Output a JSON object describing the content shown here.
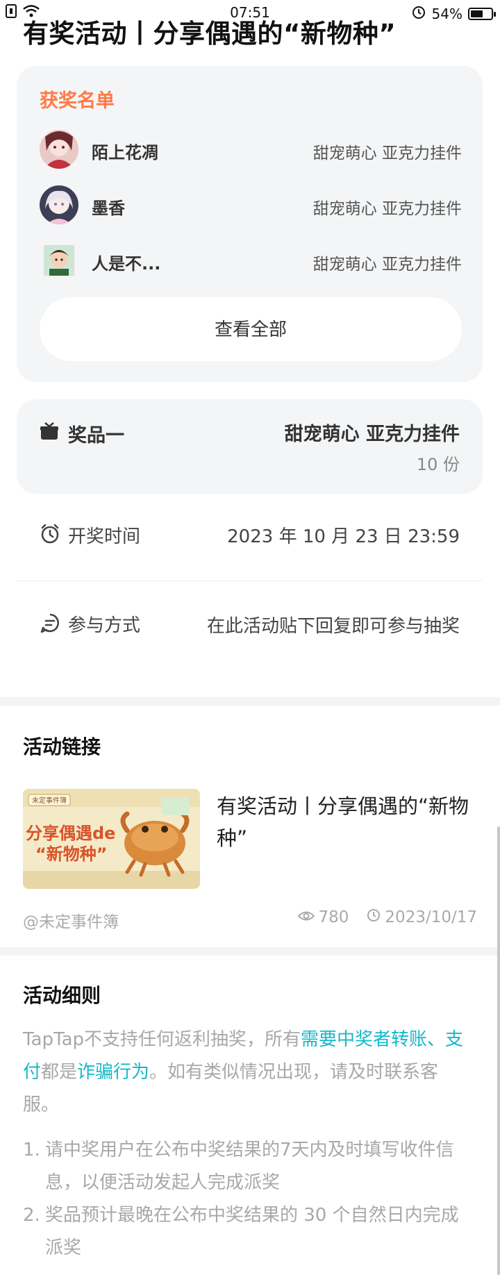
{
  "status_bar": {
    "time": "07:51",
    "battery": "54%",
    "battery_level": 0.54,
    "icons": [
      "sim-icon",
      "wifi-icon",
      "alarm-icon",
      "battery-icon"
    ]
  },
  "page": {
    "title": "有奖活动丨分享偶遇的“新物种”"
  },
  "winners": {
    "heading": "获奖名单",
    "heading_color": "#ff7a45",
    "items": [
      {
        "name": "陌上花凋",
        "prize": "甜宠萌心 亚克力挂件"
      },
      {
        "name": "墨香",
        "prize": "甜宠萌心 亚克力挂件"
      },
      {
        "name": "人是不...",
        "prize": "甜宠萌心 亚克力挂件"
      }
    ],
    "view_all": "查看全部"
  },
  "prize": {
    "label": "奖品一",
    "name": "甜宠萌心 亚克力挂件",
    "quantity": "10 份"
  },
  "draw_time": {
    "label": "开奖时间",
    "value": "2023 年 10 月 23 日 23:59"
  },
  "participation": {
    "label": "参与方式",
    "value": "在此活动贴下回复即可参与抽奖"
  },
  "activity_link": {
    "section_title": "活动链接",
    "title": "有奖活动丨分享偶遇的“新物种”",
    "author": "@未定事件簿",
    "views": "780",
    "date": "2023/10/17"
  },
  "rules": {
    "section_title": "活动细则",
    "intro_parts": [
      {
        "text": "TapTap不支持任何返利抽奖，所有",
        "highlight": false
      },
      {
        "text": "需要中奖者转账、支付",
        "highlight": true
      },
      {
        "text": "都是",
        "highlight": false
      },
      {
        "text": "诈骗行为",
        "highlight": true
      },
      {
        "text": "。如有类似情况出现，请及时联系客服。",
        "highlight": false
      }
    ],
    "highlight_color": "#14b9c8",
    "items": [
      {
        "num": "1.",
        "text": "请中奖用户在公布中奖结果的7天内及时填写收件信息，以便活动发起人完成派奖"
      },
      {
        "num": "2.",
        "text": "奖品预计最晚在公布中奖结果的 30 个自然日内完成派奖"
      }
    ]
  }
}
